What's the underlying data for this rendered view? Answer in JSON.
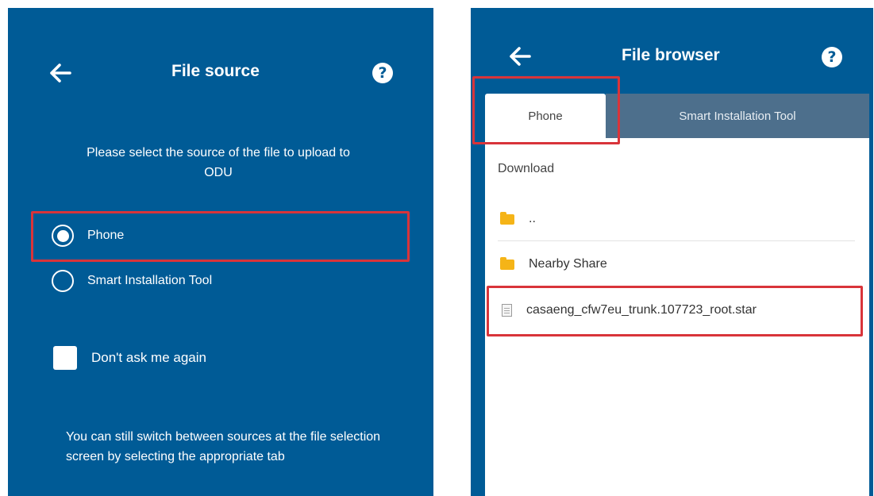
{
  "file_source": {
    "title": "File source",
    "help_icon": "?",
    "prompt": "Please select the source of the file to upload to ODU",
    "options": [
      {
        "label": "Phone",
        "selected": true
      },
      {
        "label": "Smart Installation Tool",
        "selected": false
      }
    ],
    "dont_ask_label": "Don't ask me again",
    "dont_ask_checked": false,
    "footnote": "You can still switch between sources at the file selection screen by selecting the appropriate tab"
  },
  "file_browser": {
    "title": "File browser",
    "help_icon": "?",
    "tabs": [
      {
        "label": "Phone",
        "active": true
      },
      {
        "label": "Smart Installation Tool",
        "active": false
      }
    ],
    "current_folder": "Download",
    "entries": [
      {
        "type": "folder",
        "name": ".."
      },
      {
        "type": "folder",
        "name": "Nearby Share"
      },
      {
        "type": "file",
        "name": "casaeng_cfw7eu_trunk.107723_root.star"
      }
    ]
  },
  "colors": {
    "panel_bg": "#005b96",
    "highlight": "#d9343a",
    "folder": "#f5b417",
    "inactive_tab": "#4d6f8c"
  },
  "icons": {
    "back": "arrow-left-icon",
    "help": "question-circle-icon",
    "folder": "folder-icon",
    "file": "document-icon"
  }
}
